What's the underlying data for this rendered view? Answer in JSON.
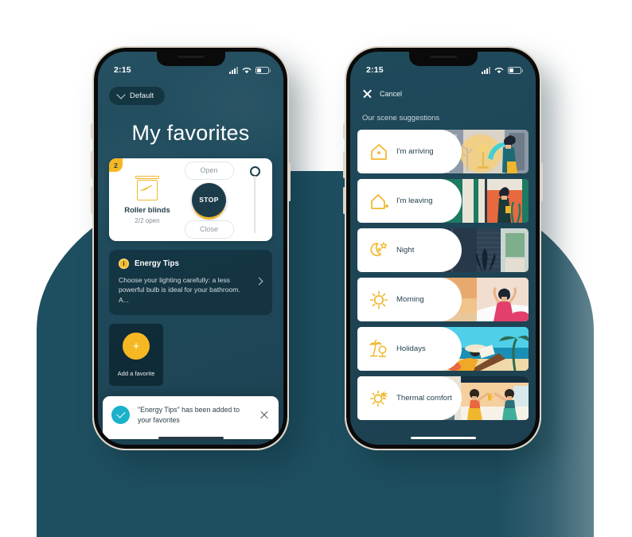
{
  "scene": {
    "background_color": "#1e4f60",
    "accent_yellow": "#f5b722",
    "dark_teal": "#1e4959",
    "page_bg": "#ffffff"
  },
  "left_phone": {
    "status_bar": {
      "time": "2:15",
      "icons": [
        "cellular-icon",
        "wifi-icon",
        "battery-icon"
      ]
    },
    "house_selector": {
      "label": "Default",
      "icon": "chevron-down-icon"
    },
    "page_title": "My favorites",
    "blinds_card": {
      "badge": "2",
      "icon": "roller-blind-icon",
      "name": "Roller blinds",
      "status": "2/2 open",
      "open_label": "Open",
      "stop_label": "STOP",
      "close_label": "Close",
      "slider_position_percent": 100
    },
    "energy_tips_card": {
      "badge_icon": "info-coin-icon",
      "title": "Energy Tips",
      "body": "Choose your lighting carefully: a less powerful bulb is ideal for your bathroom. A...",
      "chevron": "chevron-right-icon"
    },
    "add_favorite": {
      "plus_icon": "plus-icon",
      "label": "Add a favorite"
    },
    "toast": {
      "icon": "check-circle-icon",
      "message": "\"Energy Tips\" has been added to your favorites",
      "close_icon": "close-icon"
    }
  },
  "right_phone": {
    "status_bar": {
      "time": "2:15",
      "icons": [
        "cellular-icon",
        "wifi-icon",
        "battery-icon"
      ]
    },
    "top_bar": {
      "close_icon": "close-icon",
      "cancel_label": "Cancel"
    },
    "section_label": "Our scene suggestions",
    "scenes": [
      {
        "label": "I'm arriving",
        "icon": "house-filled-dot-icon"
      },
      {
        "label": "I'm leaving",
        "icon": "house-outline-dot-icon"
      },
      {
        "label": "Night",
        "icon": "moon-stars-icon"
      },
      {
        "label": "Morning",
        "icon": "sun-icon"
      },
      {
        "label": "Holidays",
        "icon": "palm-tree-icon"
      },
      {
        "label": "Thermal comfort",
        "icon": "sun-snowflake-icon"
      }
    ]
  }
}
